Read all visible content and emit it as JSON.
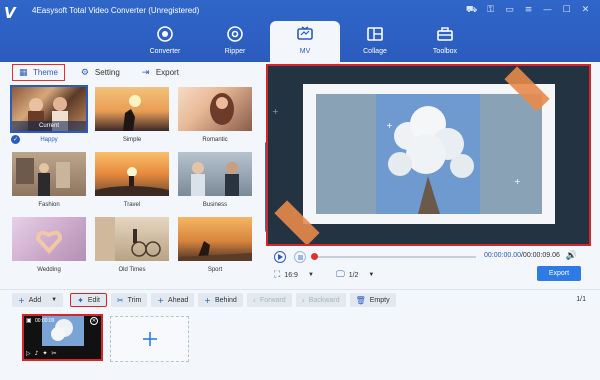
{
  "app": {
    "title": "4Easysoft Total Video Converter (Unregistered)"
  },
  "nav": {
    "items": [
      {
        "label": "Converter",
        "icon": "converter-icon"
      },
      {
        "label": "Ripper",
        "icon": "disc-icon"
      },
      {
        "label": "MV",
        "icon": "tv-icon",
        "active": true
      },
      {
        "label": "Collage",
        "icon": "collage-icon"
      },
      {
        "label": "Toolbox",
        "icon": "toolbox-icon"
      }
    ]
  },
  "subtabs": {
    "theme": "Theme",
    "setting": "Setting",
    "export": "Export"
  },
  "themes": [
    {
      "name": "Happy",
      "badge": "Current",
      "selected": true
    },
    {
      "name": "Simple"
    },
    {
      "name": "Romantic"
    },
    {
      "name": "Fashion"
    },
    {
      "name": "Travel"
    },
    {
      "name": "Business"
    },
    {
      "name": "Wedding"
    },
    {
      "name": "Old Times"
    },
    {
      "name": "Sport"
    }
  ],
  "player": {
    "current_time": "00:00:00.00",
    "total_time": "/00:00:09.06",
    "ratio": "16:9",
    "page": "1/2",
    "export_label": "Export",
    "progress": 0
  },
  "toolbar": {
    "add": "Add",
    "edit": "Edit",
    "trim": "Trim",
    "ahead": "Ahead",
    "behind": "Behind",
    "forward": "Forward",
    "backward": "Backward",
    "empty": "Empty",
    "page_count": "1/1"
  },
  "clip": {
    "duration": "00:00:09"
  },
  "colors": {
    "brand": "#2b5cbd",
    "highlight": "#d7262b",
    "accent": "#2f7be6"
  }
}
